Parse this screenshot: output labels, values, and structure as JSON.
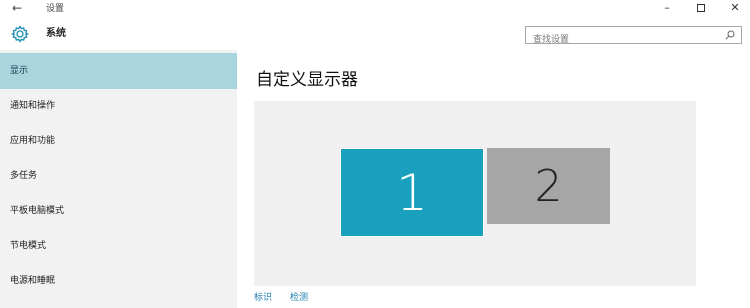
{
  "window": {
    "back_glyph": "←",
    "title": "设置",
    "min_glyph": "–",
    "close_glyph": "✕"
  },
  "header": {
    "section_title": "系统",
    "search_placeholder": "查找设置"
  },
  "sidebar": {
    "items": [
      {
        "label": "显示",
        "active": true
      },
      {
        "label": "通知和操作"
      },
      {
        "label": "应用和功能"
      },
      {
        "label": "多任务"
      },
      {
        "label": "平板电脑模式"
      },
      {
        "label": "节电模式"
      },
      {
        "label": "电源和睡眠"
      }
    ]
  },
  "main": {
    "title": "自定义显示器",
    "monitors": [
      {
        "number": "1",
        "selected": true
      },
      {
        "number": "2"
      }
    ],
    "links": {
      "identify": "标识",
      "detect": "检测"
    }
  },
  "colors": {
    "accent": "#18a0be",
    "selected_nav": "#a9d5de",
    "sidebar_bg": "#f2f2f2",
    "link": "#1f7fae"
  },
  "icons": [
    "back-arrow-icon",
    "gear-icon",
    "search-icon",
    "minimize-icon",
    "maximize-icon",
    "close-icon"
  ]
}
